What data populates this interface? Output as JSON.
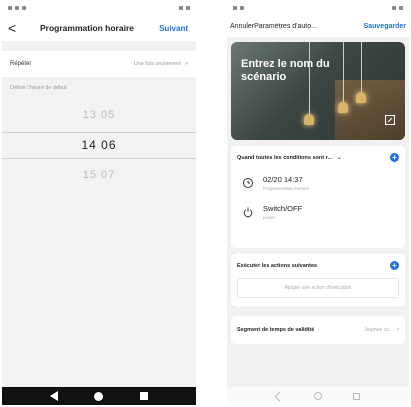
{
  "left_screen": {
    "header": {
      "back_glyph": "<",
      "title": "Programmation horaire",
      "next_label": "Suivant"
    },
    "repeat": {
      "label": "Répéter",
      "value": "Une fois seulement",
      "chevron": ">"
    },
    "start_time_label": "Définir l'heure de début",
    "time_picker": {
      "rows": [
        {
          "hour": "13",
          "minute": "05"
        },
        {
          "hour": "14",
          "minute": "06"
        },
        {
          "hour": "15",
          "minute": "07"
        }
      ],
      "selected_index": 1
    },
    "colors": {
      "accent": "#1e73d8",
      "background": "#f2f2f2"
    }
  },
  "right_screen": {
    "header": {
      "cancel_label": "Annuler",
      "title": "Paramètres d'auto...",
      "save_label": "Sauvegarder"
    },
    "banner": {
      "title": "Entrez le nom du scénario"
    },
    "conditions": {
      "title": "Quand toutes les conditions sont r...",
      "dropdown_glyph": "⌄",
      "items": [
        {
          "main": "02/20 14:37",
          "sub": "Programmation horaire",
          "icon": "clock-icon"
        },
        {
          "main": "Switch/OFF",
          "sub": "power",
          "icon": "power-icon"
        }
      ]
    },
    "actions": {
      "title": "Exécuter les actions suivantes",
      "add_label": "Ajouter une action d'exécution"
    },
    "validity": {
      "label": "Segment de temps de validité",
      "value": "Journée co...",
      "chevron": ">"
    },
    "colors": {
      "accent": "#1e73d8",
      "background": "#f1f1f1"
    }
  }
}
